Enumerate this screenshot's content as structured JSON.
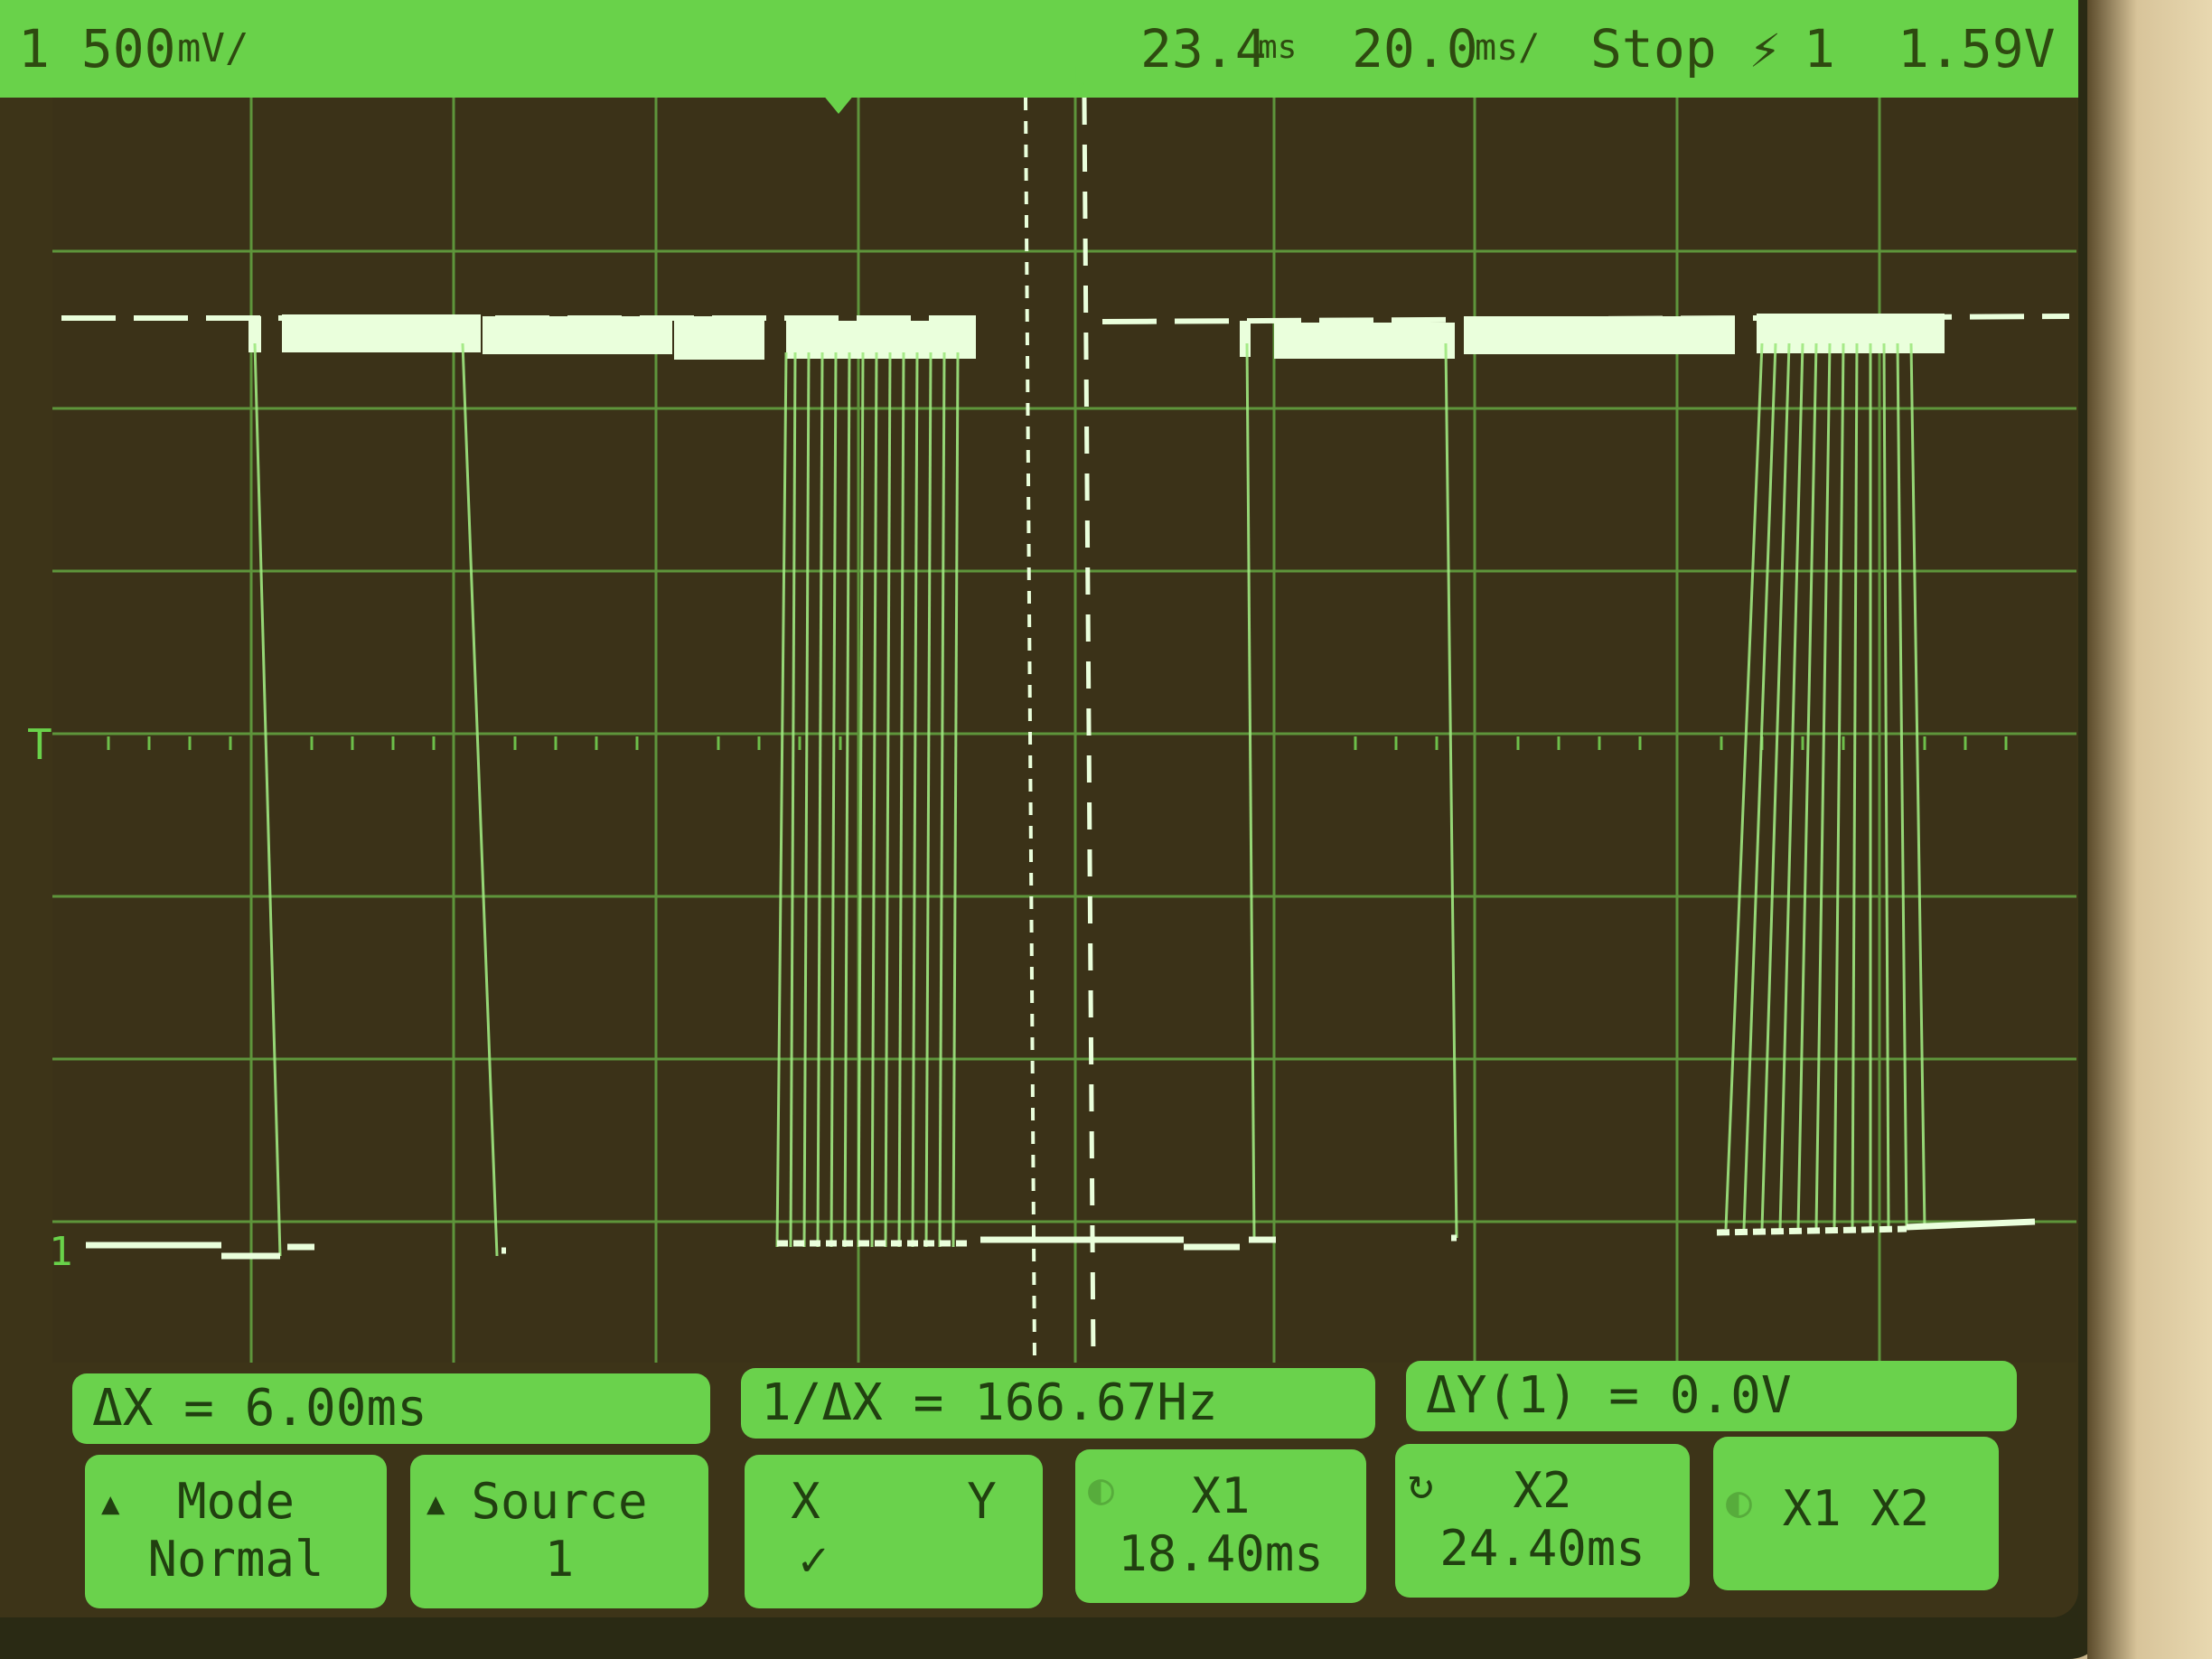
{
  "header": {
    "channel_scale": "1 500",
    "channel_unit": "mV/",
    "time_delay": "23.4",
    "time_delay_unit": "ms",
    "time_base": "20.0",
    "time_base_unit": "ms/",
    "run_state": "Stop",
    "trigger_source": "1",
    "trigger_level": "1.59V"
  },
  "measurements": {
    "delta_x": "ΔX = 6.00ms",
    "inv_delta_x": "1/ΔX = 166.67Hz",
    "delta_y": "ΔY(1) = 0.0V"
  },
  "softkeys": {
    "mode": {
      "title": "Mode",
      "value": "Normal"
    },
    "source": {
      "title": "Source",
      "value": "1"
    },
    "xy": {
      "x": "X",
      "y": "Y",
      "check": "✓"
    },
    "x1": {
      "title": "X1",
      "value": "18.40ms"
    },
    "x2": {
      "title": "X2",
      "value": "24.40ms"
    },
    "x1x2": {
      "label": "X1 X2"
    }
  },
  "markers": {
    "trigger_level": "T",
    "ground": "1"
  },
  "colors": {
    "trace": "#eaffdc",
    "grid": "#6dbf4a",
    "panel": "#6ad24c",
    "screen": "#3d3418"
  }
}
